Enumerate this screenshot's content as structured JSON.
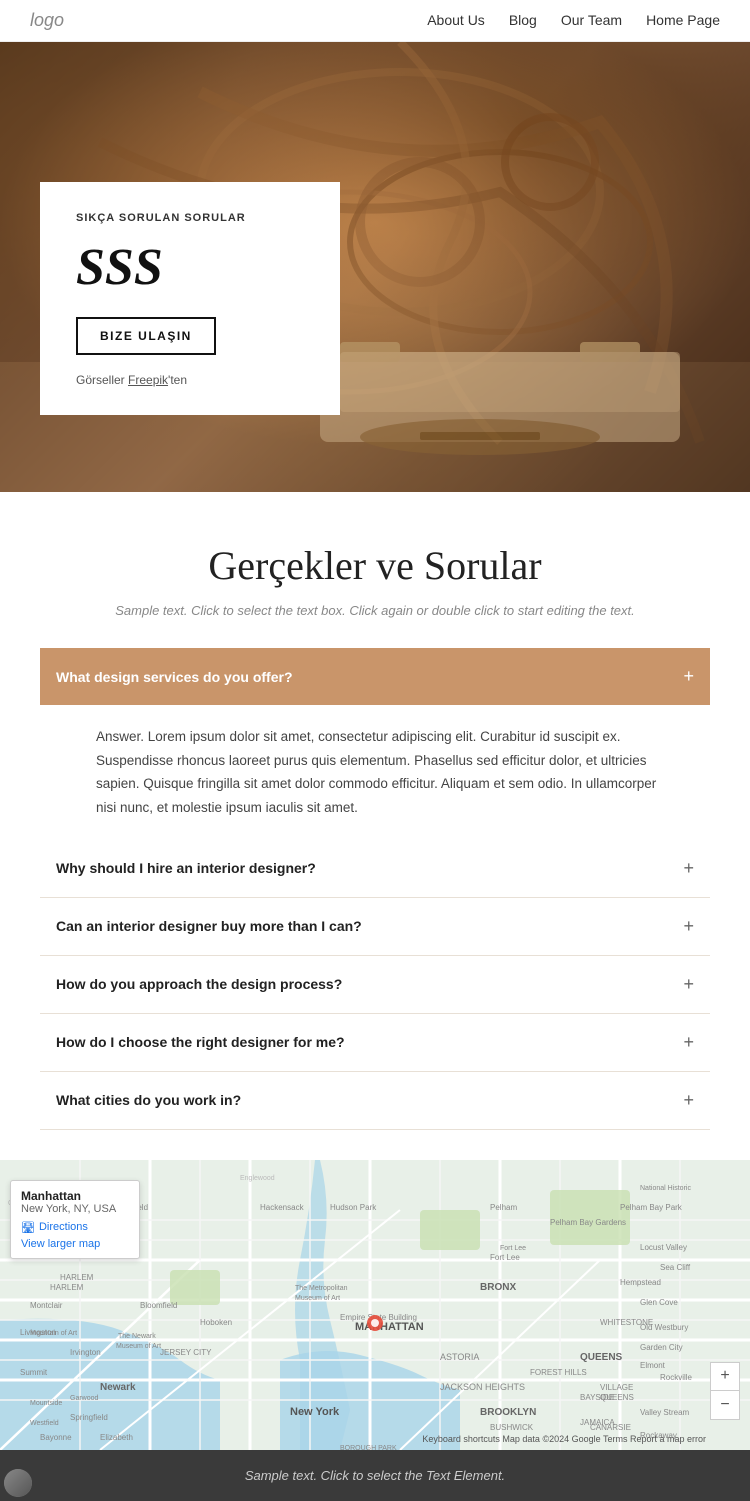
{
  "navbar": {
    "logo": "logo",
    "links": [
      {
        "label": "About Us",
        "href": "#"
      },
      {
        "label": "Blog",
        "href": "#"
      },
      {
        "label": "Our Team",
        "href": "#"
      },
      {
        "label": "Home Page",
        "href": "#"
      }
    ]
  },
  "hero": {
    "subtitle": "SIKÇA SORULAN SORULAR",
    "title": "SSS",
    "button_label": "BIZE ULAŞIN",
    "credit_prefix": "Görseller ",
    "credit_link": "Freepik",
    "credit_suffix": "'ten"
  },
  "main_section": {
    "title": "Gerçekler ve Sorular",
    "description": "Sample text. Click to select the text box. Click again or double click to start editing the text."
  },
  "faq": {
    "items": [
      {
        "id": 1,
        "question": "What design services do you offer?",
        "answer": "Answer. Lorem ipsum dolor sit amet, consectetur adipiscing elit. Curabitur id suscipit ex. Suspendisse rhoncus laoreet purus quis elementum. Phasellus sed efficitur dolor, et ultricies sapien. Quisque fringilla sit amet dolor commodo efficitur. Aliquam et sem odio. In ullamcorper nisi nunc, et molestie ipsum iaculis sit amet.",
        "open": true
      },
      {
        "id": 2,
        "question": "Why should I hire an interior designer?",
        "answer": "",
        "open": false
      },
      {
        "id": 3,
        "question": "Can an interior designer buy more than I can?",
        "answer": "",
        "open": false
      },
      {
        "id": 4,
        "question": "How do you approach the design process?",
        "answer": "",
        "open": false
      },
      {
        "id": 5,
        "question": "How do I choose the right designer for me?",
        "answer": "",
        "open": false
      },
      {
        "id": 6,
        "question": "What cities do you work in?",
        "answer": "",
        "open": false
      }
    ]
  },
  "map": {
    "location_title": "Manhattan",
    "location_sub": "New York, NY, USA",
    "directions_label": "Directions",
    "view_larger_label": "View larger map",
    "credit": "Keyboard shortcuts  Map data ©2024 Google  Terms  Report a map error"
  },
  "footer": {
    "text": "Sample text. Click to select the Text Element."
  }
}
